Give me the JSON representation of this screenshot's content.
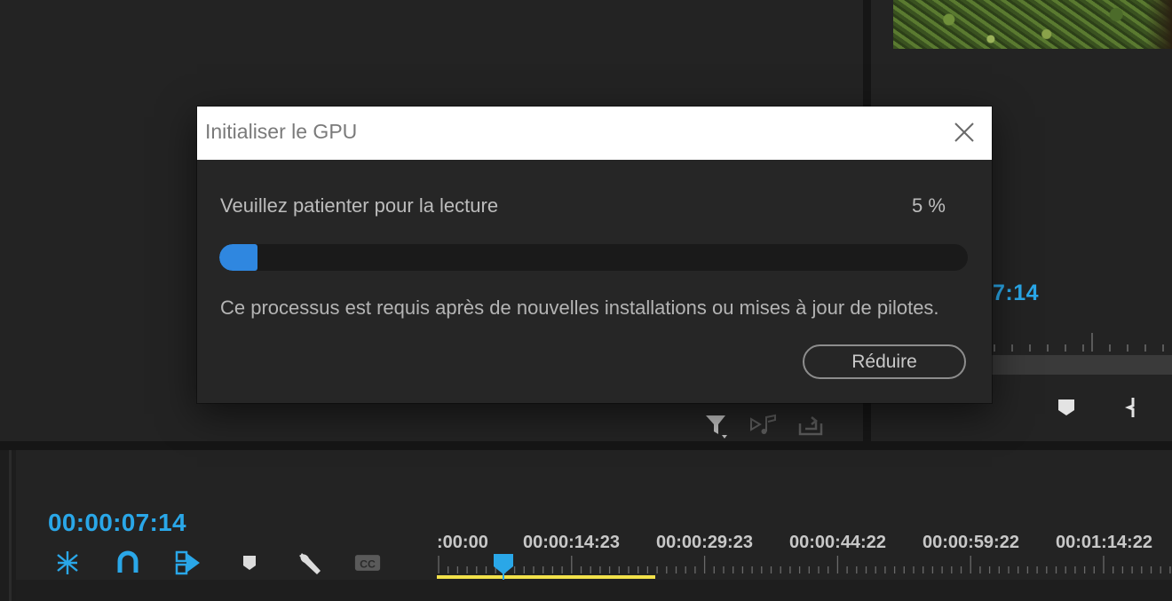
{
  "dialog": {
    "title": "Initialiser le GPU",
    "message": "Veuillez patienter pour la lecture",
    "percent_label": "5 %",
    "progress_percent": 5,
    "info": "Ce processus est requis après de nouvelles installations ou mises à jour de pilotes.",
    "reduce_label": "Réduire",
    "close_icon": "close-icon",
    "accent_color": "#2f87e0"
  },
  "program_monitor": {
    "timecode_partial": "7:14"
  },
  "project_toolbar": {
    "icons": [
      "filter-icon",
      "automate-to-sequence-icon",
      "export-icon"
    ]
  },
  "timeline": {
    "timecode": "00:00:07:14",
    "timecode_color": "#2aa7e8",
    "tools": [
      "snap-nested-icon",
      "snap-magnet-icon",
      "linked-selection-icon",
      "add-marker-icon",
      "settings-wrench-icon",
      "captions-cc-icon"
    ],
    "ruler_labels": [
      ":00:00",
      "00:00:14:23",
      "00:00:29:23",
      "00:00:44:22",
      "00:00:59:22",
      "00:01:14:22"
    ],
    "work_area_color": "#f2e14a",
    "playhead_color": "#2aa7e8"
  }
}
